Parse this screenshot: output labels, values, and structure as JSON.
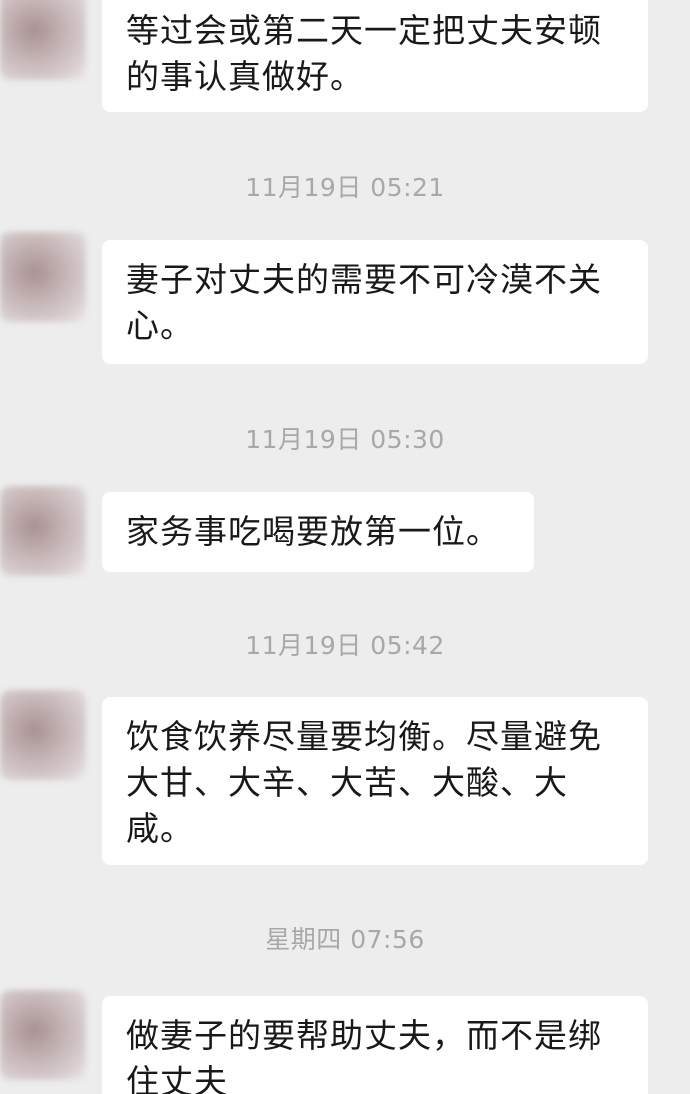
{
  "messages": [
    {
      "text": "等过会或第二天一定把丈夫安顿的事认真做好。"
    },
    {
      "time": "11月19日 05:21",
      "text": "妻子对丈夫的需要不可冷漠不关心。"
    },
    {
      "time": "11月19日 05:30",
      "text": "家务事吃喝要放第一位。"
    },
    {
      "time": "11月19日 05:42",
      "text": "饮食饮养尽量要均衡。尽量避免大甘、大辛、大苦、大酸、大咸。"
    },
    {
      "time": "星期四 07:56",
      "text": "做妻子的要帮助丈夫，而不是绑住丈夫"
    }
  ]
}
